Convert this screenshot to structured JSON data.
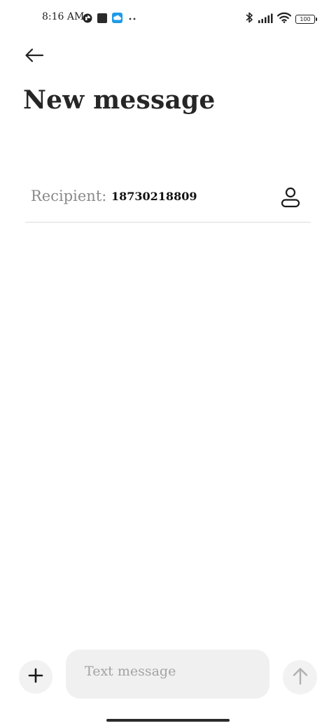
{
  "status_bar": {
    "time": "8:16 AM",
    "battery_level": "100",
    "left_icons": [
      "record-icon",
      "square-app-icon",
      "cloud-app-icon",
      "more-dots-icon"
    ],
    "right_icons": [
      "bluetooth-icon",
      "signal-icon",
      "wifi-icon",
      "battery-icon"
    ]
  },
  "header": {
    "back_icon": "arrow-left-icon",
    "title": "New message"
  },
  "recipient": {
    "label": "Recipient:",
    "value": "18730218809",
    "contact_icon": "person-icon"
  },
  "composer": {
    "add_icon": "plus-icon",
    "placeholder": "Text message",
    "send_icon": "arrow-up-icon"
  },
  "colors": {
    "background": "#ffffff",
    "title": "#262626",
    "label": "#8a8a8a",
    "divider": "#dcdcdc",
    "composer_bg": "#f0f0f0",
    "cloud_app": "#1e9be8"
  }
}
